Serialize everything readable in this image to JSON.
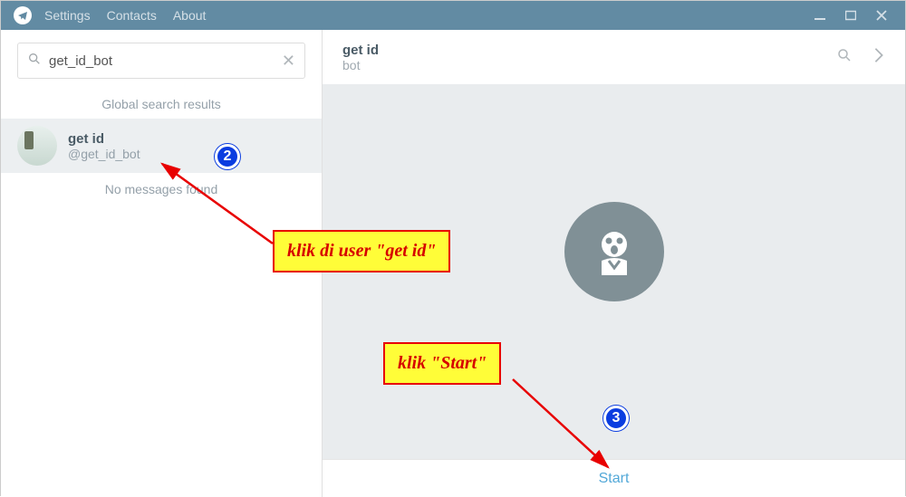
{
  "menu": {
    "settings": "Settings",
    "contacts": "Contacts",
    "about": "About"
  },
  "search": {
    "value": "get_id_bot"
  },
  "sidebar": {
    "global_label": "Global search results",
    "no_messages": "No messages found",
    "result": {
      "name": "get id",
      "username": "@get_id_bot"
    }
  },
  "chat": {
    "title": "get id",
    "subtitle": "bot",
    "start": "Start"
  },
  "annotations": {
    "callout_user": "klik di user \"get id\"",
    "callout_start": "klik \"Start\"",
    "badge2": "2",
    "badge3": "3"
  }
}
